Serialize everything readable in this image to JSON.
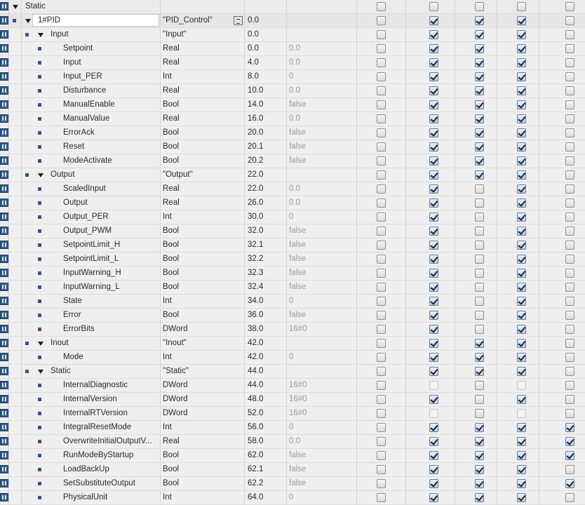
{
  "table": {
    "rows": [
      {
        "level": 0,
        "expand": true,
        "name": "Static",
        "dtype": "",
        "offset": "",
        "defval": "",
        "cb": [
          0,
          0,
          0,
          0,
          0
        ],
        "hdr": true
      },
      {
        "level": 1,
        "expand": true,
        "name": "1#PID",
        "dtype": "\"PID_Control\"",
        "offset": "0.0",
        "defval": "",
        "cb": [
          0,
          1,
          1,
          1,
          0
        ],
        "sel": true,
        "typebtn": true
      },
      {
        "level": 2,
        "expand": true,
        "name": "Input",
        "dtype": "\"Input\"",
        "offset": "0.0",
        "defval": "",
        "cb": [
          0,
          1,
          1,
          1,
          0
        ]
      },
      {
        "level": 3,
        "name": "Setpoint",
        "dtype": "Real",
        "offset": "0.0",
        "defval": "0.0",
        "cb": [
          0,
          1,
          1,
          1,
          0
        ]
      },
      {
        "level": 3,
        "name": "Input",
        "dtype": "Real",
        "offset": "4.0",
        "defval": "0.0",
        "cb": [
          0,
          1,
          1,
          1,
          0
        ]
      },
      {
        "level": 3,
        "name": "Input_PER",
        "dtype": "Int",
        "offset": "8.0",
        "defval": "0",
        "cb": [
          0,
          1,
          1,
          1,
          0
        ]
      },
      {
        "level": 3,
        "name": "Disturbance",
        "dtype": "Real",
        "offset": "10.0",
        "defval": "0.0",
        "cb": [
          0,
          1,
          1,
          1,
          0
        ]
      },
      {
        "level": 3,
        "name": "ManualEnable",
        "dtype": "Bool",
        "offset": "14.0",
        "defval": "false",
        "cb": [
          0,
          1,
          1,
          1,
          0
        ]
      },
      {
        "level": 3,
        "name": "ManualValue",
        "dtype": "Real",
        "offset": "16.0",
        "defval": "0.0",
        "cb": [
          0,
          1,
          1,
          1,
          0
        ]
      },
      {
        "level": 3,
        "name": "ErrorAck",
        "dtype": "Bool",
        "offset": "20.0",
        "defval": "false",
        "cb": [
          0,
          1,
          1,
          1,
          0
        ]
      },
      {
        "level": 3,
        "name": "Reset",
        "dtype": "Bool",
        "offset": "20.1",
        "defval": "false",
        "cb": [
          0,
          1,
          1,
          1,
          0
        ]
      },
      {
        "level": 3,
        "name": "ModeActivate",
        "dtype": "Bool",
        "offset": "20.2",
        "defval": "false",
        "cb": [
          0,
          1,
          1,
          1,
          0
        ]
      },
      {
        "level": 2,
        "expand": true,
        "name": "Output",
        "dtype": "\"Output\"",
        "offset": "22.0",
        "defval": "",
        "cb": [
          0,
          1,
          1,
          1,
          0
        ]
      },
      {
        "level": 3,
        "name": "ScaledInput",
        "dtype": "Real",
        "offset": "22.0",
        "defval": "0.0",
        "cb": [
          0,
          1,
          0,
          1,
          0
        ]
      },
      {
        "level": 3,
        "name": "Output",
        "dtype": "Real",
        "offset": "26.0",
        "defval": "0.0",
        "cb": [
          0,
          1,
          0,
          1,
          0
        ]
      },
      {
        "level": 3,
        "name": "Output_PER",
        "dtype": "Int",
        "offset": "30.0",
        "defval": "0",
        "cb": [
          0,
          1,
          0,
          1,
          0
        ]
      },
      {
        "level": 3,
        "name": "Output_PWM",
        "dtype": "Bool",
        "offset": "32.0",
        "defval": "false",
        "cb": [
          0,
          1,
          0,
          1,
          0
        ]
      },
      {
        "level": 3,
        "name": "SetpointLimit_H",
        "dtype": "Bool",
        "offset": "32.1",
        "defval": "false",
        "cb": [
          0,
          1,
          0,
          1,
          0
        ]
      },
      {
        "level": 3,
        "name": "SetpointLimit_L",
        "dtype": "Bool",
        "offset": "32.2",
        "defval": "false",
        "cb": [
          0,
          1,
          0,
          1,
          0
        ]
      },
      {
        "level": 3,
        "name": "InputWarning_H",
        "dtype": "Bool",
        "offset": "32.3",
        "defval": "false",
        "cb": [
          0,
          1,
          0,
          1,
          0
        ]
      },
      {
        "level": 3,
        "name": "InputWarning_L",
        "dtype": "Bool",
        "offset": "32.4",
        "defval": "false",
        "cb": [
          0,
          1,
          0,
          1,
          0
        ]
      },
      {
        "level": 3,
        "name": "State",
        "dtype": "Int",
        "offset": "34.0",
        "defval": "0",
        "cb": [
          0,
          1,
          0,
          1,
          0
        ]
      },
      {
        "level": 3,
        "name": "Error",
        "dtype": "Bool",
        "offset": "36.0",
        "defval": "false",
        "cb": [
          0,
          1,
          0,
          1,
          0
        ]
      },
      {
        "level": 3,
        "name": "ErrorBits",
        "dtype": "DWord",
        "offset": "38.0",
        "defval": "16#0",
        "cb": [
          0,
          1,
          0,
          1,
          0
        ]
      },
      {
        "level": 2,
        "expand": true,
        "name": "Inout",
        "dtype": "\"Inout\"",
        "offset": "42.0",
        "defval": "",
        "cb": [
          0,
          1,
          1,
          1,
          0
        ]
      },
      {
        "level": 3,
        "name": "Mode",
        "dtype": "Int",
        "offset": "42.0",
        "defval": "0",
        "cb": [
          0,
          1,
          1,
          1,
          0
        ]
      },
      {
        "level": 2,
        "expand": true,
        "name": "Static",
        "dtype": "\"Static\"",
        "offset": "44.0",
        "defval": "",
        "cb": [
          0,
          1,
          1,
          1,
          0
        ]
      },
      {
        "level": 3,
        "name": "InternalDiagnostic",
        "dtype": "DWord",
        "offset": "44.0",
        "defval": "16#0",
        "cb": [
          0,
          2,
          0,
          2,
          0
        ]
      },
      {
        "level": 3,
        "name": "InternalVersion",
        "dtype": "DWord",
        "offset": "48.0",
        "defval": "16#0",
        "cb": [
          0,
          1,
          0,
          1,
          0
        ]
      },
      {
        "level": 3,
        "name": "InternalRTVersion",
        "dtype": "DWord",
        "offset": "52.0",
        "defval": "16#0",
        "cb": [
          0,
          2,
          0,
          2,
          0
        ]
      },
      {
        "level": 3,
        "name": "IntegralResetMode",
        "dtype": "Int",
        "offset": "56.0",
        "defval": "0",
        "cb": [
          0,
          1,
          1,
          1,
          1
        ]
      },
      {
        "level": 3,
        "name": "OverwriteInitialOutputV...",
        "dtype": "Real",
        "offset": "58.0",
        "defval": "0.0",
        "cb": [
          0,
          1,
          1,
          1,
          1
        ]
      },
      {
        "level": 3,
        "name": "RunModeByStartup",
        "dtype": "Bool",
        "offset": "62.0",
        "defval": "false",
        "cb": [
          0,
          1,
          1,
          1,
          1
        ]
      },
      {
        "level": 3,
        "name": "LoadBackUp",
        "dtype": "Bool",
        "offset": "62.1",
        "defval": "false",
        "cb": [
          0,
          1,
          1,
          1,
          0
        ]
      },
      {
        "level": 3,
        "name": "SetSubstituteOutput",
        "dtype": "Bool",
        "offset": "62.2",
        "defval": "false",
        "cb": [
          0,
          1,
          1,
          1,
          1
        ]
      },
      {
        "level": 3,
        "name": "PhysicalUnit",
        "dtype": "Int",
        "offset": "64.0",
        "defval": "0",
        "cb": [
          0,
          1,
          1,
          1,
          0
        ]
      }
    ]
  },
  "icons": {
    "row_icon": "interface-db-icon",
    "expand_icon": "expand-triangle-icon",
    "bullet_icon": "member-bullet-icon",
    "type_button": "data-type-browse-icon"
  }
}
